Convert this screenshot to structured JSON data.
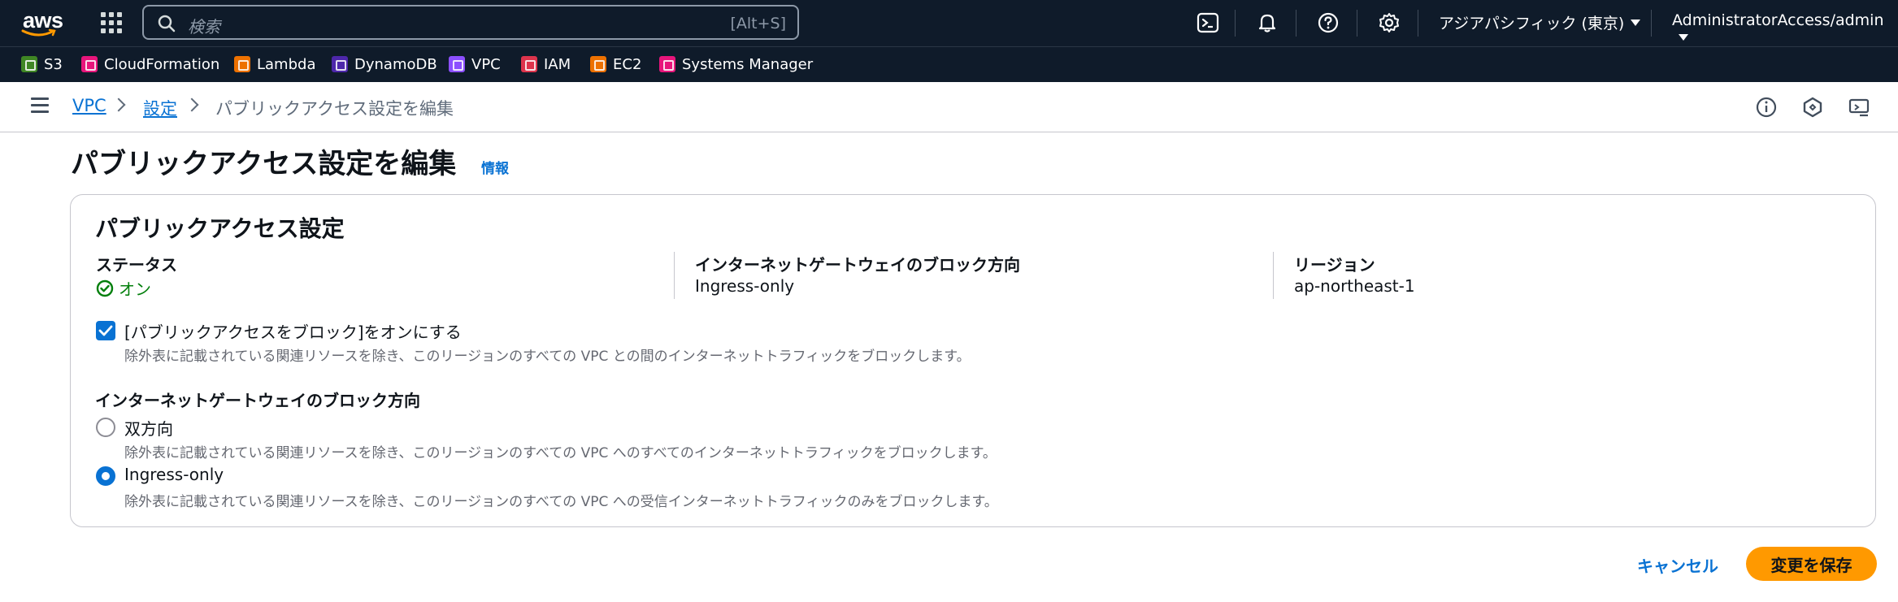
{
  "topnav": {
    "logo_text": "aws",
    "search_placeholder": "検索",
    "search_shortcut": "[Alt+S]",
    "icons": [
      "apps-grid-icon",
      "search-icon",
      "cloudshell-icon",
      "notifications-icon",
      "help-icon",
      "settings-icon"
    ],
    "region": "アジアパシフィック (東京)",
    "account": "AdministratorAccess/admin"
  },
  "favorites": [
    {
      "label": "S3",
      "color": "#3f8624"
    },
    {
      "label": "CloudFormation",
      "color": "#e7157b"
    },
    {
      "label": "Lambda",
      "color": "#ed7100"
    },
    {
      "label": "DynamoDB",
      "color": "#4d27aa"
    },
    {
      "label": "VPC",
      "color": "#8c4fff"
    },
    {
      "label": "IAM",
      "color": "#dd344c"
    },
    {
      "label": "EC2",
      "color": "#ed7100"
    },
    {
      "label": "Systems Manager",
      "color": "#e7157b"
    }
  ],
  "breadcrumb": {
    "items": [
      "VPC",
      "設定",
      "パブリックアクセス設定を編集"
    ]
  },
  "page": {
    "title": "パブリックアクセス設定を編集",
    "info": "情報"
  },
  "panel": {
    "title": "パブリックアクセス設定",
    "status_label": "ステータス",
    "status_value": "オン",
    "direction_label": "インターネットゲートウェイのブロック方向",
    "direction_value": "Ingress-only",
    "region_label": "リージョン",
    "region_value": "ap-northeast-1",
    "block_checkbox_label": "[パブリックアクセスをブロック]をオンにする",
    "block_checkbox_desc": "除外表に記載されている関連リソースを除き、このリージョンのすべての VPC との間のインターネットトラフィックをブロックします。",
    "block_checkbox_checked": true,
    "direction_section_label": "インターネットゲートウェイのブロック方向",
    "options": [
      {
        "label": "双方向",
        "desc": "除外表に記載されている関連リソースを除き、このリージョンのすべての VPC へのすべてのインターネットトラフィックをブロックします。",
        "selected": false
      },
      {
        "label": "Ingress-only",
        "desc": "除外表に記載されている関連リソースを除き、このリージョンのすべての VPC への受信インターネットトラフィックのみをブロックします。",
        "selected": true
      }
    ]
  },
  "footer": {
    "cancel": "キャンセル",
    "save": "変更を保存"
  },
  "colors": {
    "nav_bg": "#0f1b2a",
    "link": "#0972d3",
    "primary_button": "#ff9900",
    "status_success": "#037f0c"
  }
}
